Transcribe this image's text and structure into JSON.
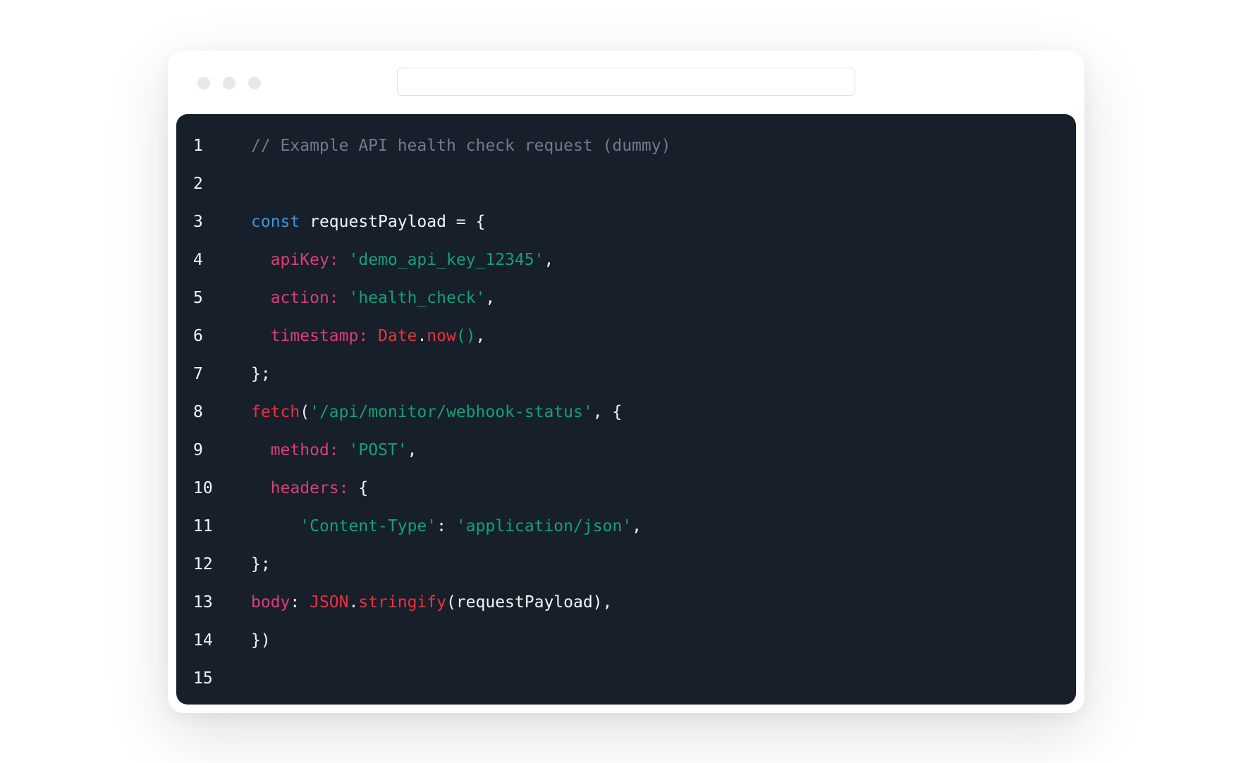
{
  "window": {
    "url_value": ""
  },
  "editor": {
    "lines": [
      {
        "n": "1",
        "indent": "",
        "tokens": [
          {
            "t": "// Example API health check request (dummy)",
            "c": "comment"
          }
        ]
      },
      {
        "n": "2",
        "indent": "",
        "tokens": []
      },
      {
        "n": "3",
        "indent": "",
        "tokens": [
          {
            "t": "const",
            "c": "kw"
          },
          {
            "t": " requestPayload = {",
            "c": "plain"
          }
        ]
      },
      {
        "n": "4",
        "indent": "  ",
        "tokens": [
          {
            "t": "apiKey:",
            "c": "key"
          },
          {
            "t": " ",
            "c": "plain"
          },
          {
            "t": "'demo_api_key_12345'",
            "c": "str"
          },
          {
            "t": ",",
            "c": "plain"
          }
        ]
      },
      {
        "n": "5",
        "indent": "  ",
        "tokens": [
          {
            "t": "action:",
            "c": "key"
          },
          {
            "t": " ",
            "c": "plain"
          },
          {
            "t": "'health_check'",
            "c": "str"
          },
          {
            "t": ",",
            "c": "plain"
          }
        ]
      },
      {
        "n": "6",
        "indent": "  ",
        "tokens": [
          {
            "t": "timestamp:",
            "c": "key"
          },
          {
            "t": " ",
            "c": "plain"
          },
          {
            "t": "Date",
            "c": "fn"
          },
          {
            "t": ".",
            "c": "plain"
          },
          {
            "t": "now",
            "c": "fn"
          },
          {
            "t": "()",
            "c": "str"
          },
          {
            "t": ",",
            "c": "plain"
          }
        ]
      },
      {
        "n": "7",
        "indent": "",
        "tokens": [
          {
            "t": "};",
            "c": "plain"
          }
        ]
      },
      {
        "n": "8",
        "indent": "",
        "tokens": [
          {
            "t": "fetch",
            "c": "fn"
          },
          {
            "t": "(",
            "c": "plain"
          },
          {
            "t": "'/api/monitor/webhook-status'",
            "c": "str"
          },
          {
            "t": ", {",
            "c": "plain"
          }
        ]
      },
      {
        "n": "9",
        "indent": "  ",
        "tokens": [
          {
            "t": "method:",
            "c": "key"
          },
          {
            "t": " ",
            "c": "plain"
          },
          {
            "t": "'POST'",
            "c": "str"
          },
          {
            "t": ",",
            "c": "plain"
          }
        ]
      },
      {
        "n": "10",
        "indent": "  ",
        "tokens": [
          {
            "t": "headers:",
            "c": "key"
          },
          {
            "t": " {",
            "c": "plain"
          }
        ]
      },
      {
        "n": "11",
        "indent": "     ",
        "tokens": [
          {
            "t": "'Content-Type'",
            "c": "str"
          },
          {
            "t": ": ",
            "c": "plain"
          },
          {
            "t": "'application/json'",
            "c": "str"
          },
          {
            "t": ",",
            "c": "plain"
          }
        ]
      },
      {
        "n": "12",
        "indent": "",
        "tokens": [
          {
            "t": "};",
            "c": "plain"
          }
        ]
      },
      {
        "n": "13",
        "indent": "",
        "tokens": [
          {
            "t": "body",
            "c": "key"
          },
          {
            "t": ": ",
            "c": "plain"
          },
          {
            "t": "JSON",
            "c": "fn"
          },
          {
            "t": ".",
            "c": "plain"
          },
          {
            "t": "stringify",
            "c": "fn"
          },
          {
            "t": "(requestPayload),",
            "c": "plain"
          }
        ]
      },
      {
        "n": "14",
        "indent": "",
        "tokens": [
          {
            "t": "})",
            "c": "plain"
          }
        ]
      },
      {
        "n": "15",
        "indent": "",
        "tokens": []
      }
    ]
  },
  "colors": {
    "editor_bg": "#161f2a",
    "comment": "#6f7b88",
    "keyword": "#3d95d6",
    "property": "#dd3f79",
    "string": "#14a07a",
    "function": "#e7343f",
    "text": "#f3f5f7"
  }
}
